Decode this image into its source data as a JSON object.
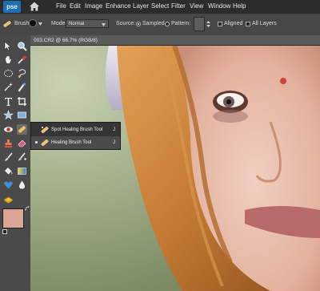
{
  "app": {
    "logo": "pse"
  },
  "menubar": {
    "items": [
      "File",
      "Edit",
      "Image",
      "Enhance",
      "Layer",
      "Select",
      "Filter",
      "View",
      "Window",
      "Help"
    ]
  },
  "options": {
    "brush_label": "Brush:",
    "mode_label": "Mode:",
    "mode_value": "Normal",
    "source_label": "Source:",
    "sampled_label": "Sampled",
    "pattern_label": "Pattern:",
    "aligned_label": "Aligned",
    "all_layers_label": "All Layers",
    "source_selected": "Sampled",
    "aligned_checked": false,
    "all_layers_checked": false
  },
  "document": {
    "tab_title": "003.CR2 @ 66.7% (RGB/8)"
  },
  "flyout": {
    "items": [
      {
        "label": "Spot Healing Brush Tool",
        "shortcut": "J",
        "selected": false,
        "icon": "spot-healing-brush-icon"
      },
      {
        "label": "Healing Brush Tool",
        "shortcut": "J",
        "selected": true,
        "icon": "healing-brush-icon"
      }
    ]
  },
  "colors": {
    "foreground": "#d9a696",
    "background": "#f2f2f2",
    "accent": "#1f6fb0"
  },
  "toolbox": {
    "tools": [
      "move-icon",
      "zoom-icon",
      "hand-icon",
      "eyedropper-icon",
      "marquee-icon",
      "lasso-icon",
      "magic-wand-icon",
      "quick-selection-icon",
      "type-icon",
      "crop-icon",
      "cookie-cutter-icon",
      "straighten-icon",
      "red-eye-icon",
      "spot-healing-icon",
      "clone-stamp-icon",
      "eraser-icon",
      "brush-icon",
      "smart-brush-icon",
      "paint-bucket-icon",
      "gradient-icon",
      "custom-shape-icon",
      "blur-icon",
      "sponge-icon",
      "color-swatch-icon"
    ]
  }
}
